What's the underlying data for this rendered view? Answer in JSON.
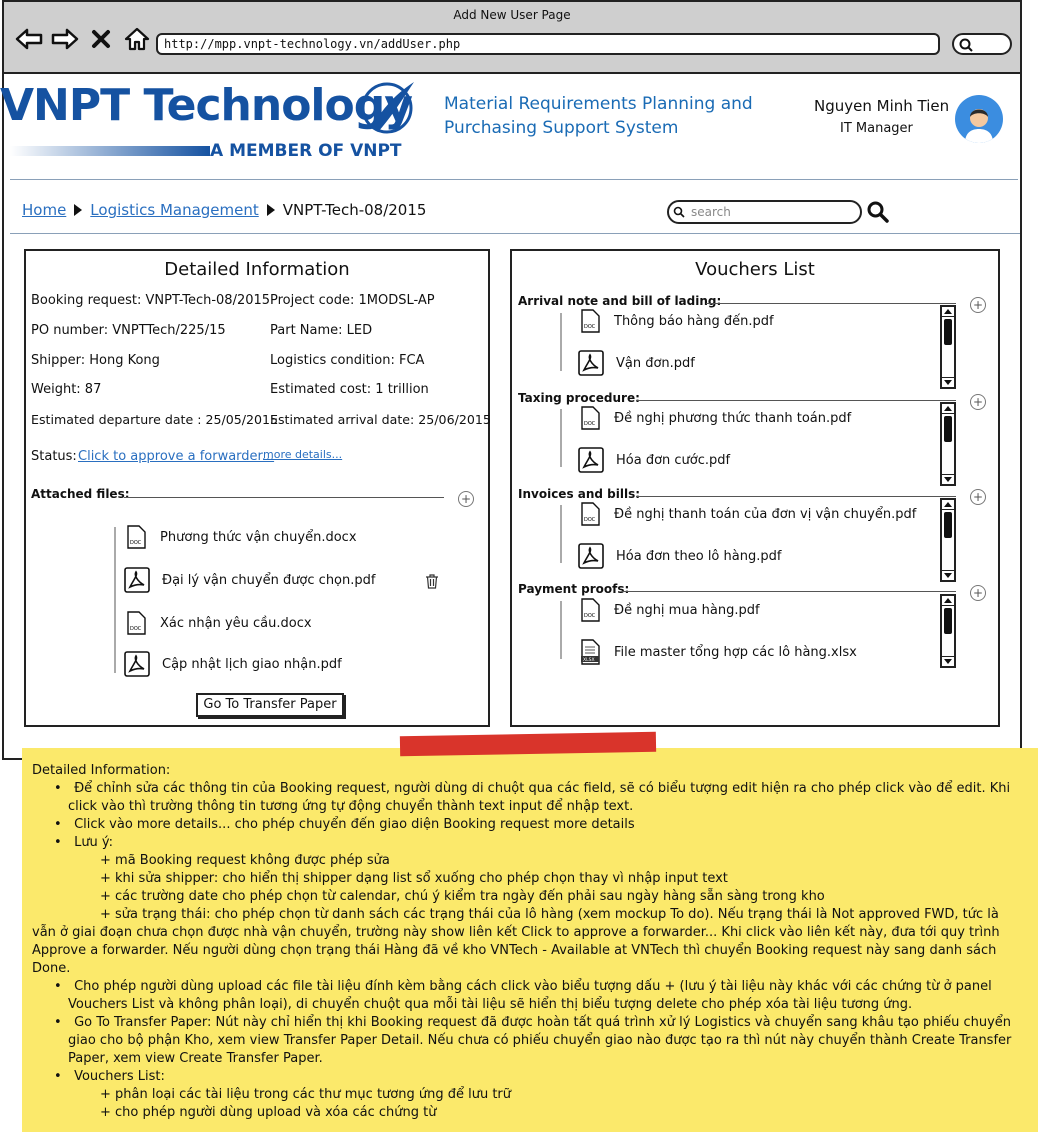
{
  "window": {
    "title": "Add New User Page",
    "url": "http://mpp.vnpt-technology.vn/addUser.php"
  },
  "header": {
    "logo_text": "VNPT Technology",
    "logo_tagline": "A MEMBER OF VNPT",
    "system_title_line1": "Material Requirements Planning and",
    "system_title_line2": "Purchasing Support System",
    "user_name": "Nguyen Minh Tien",
    "user_role": "IT Manager"
  },
  "breadcrumb": {
    "home": "Home",
    "section": "Logistics Management",
    "current": "VNPT-Tech-08/2015"
  },
  "search": {
    "placeholder": "search"
  },
  "detail": {
    "title": "Detailed Information",
    "booking_request": "Booking request: VNPT-Tech-08/2015",
    "project_code": "Project code: 1MODSL-AP",
    "po_number": "PO number: VNPTTech/225/15",
    "part_name": "Part Name: LED",
    "shipper": "Shipper: Hong Kong",
    "logistics_condition": "Logistics condition: FCA",
    "weight": "Weight: 87",
    "estimated_cost": "Estimated cost: 1 trillion",
    "departure_date": "Estimated departure date : 25/05/2015",
    "arrival_date": "Estimated arrival date: 25/06/2015",
    "status_label": "Status:",
    "status_link": "Click to approve a forwarder...",
    "more_details": "more details...",
    "attached_label": "Attached files:",
    "files": [
      {
        "name": "Phương thức vận chuyển.docx",
        "icon": "doc-icon"
      },
      {
        "name": "Đại lý vận chuyển được chọn.pdf",
        "icon": "pdf-icon"
      },
      {
        "name": "Xác nhận yêu cầu.docx",
        "icon": "doc-icon"
      },
      {
        "name": "Cập nhật lịch giao nhận.pdf",
        "icon": "pdf-icon"
      }
    ],
    "transfer_button": "Go To Transfer Paper"
  },
  "vouchers": {
    "title": "Vouchers List",
    "groups": [
      {
        "label": "Arrival note and bill of lading:",
        "files": [
          {
            "name": "Thông báo hàng đến.pdf",
            "icon": "doc-icon"
          },
          {
            "name": "Vận đơn.pdf",
            "icon": "pdf-icon"
          }
        ]
      },
      {
        "label": "Taxing procedure:",
        "files": [
          {
            "name": "Đề nghị phương thức thanh toán.pdf",
            "icon": "doc-icon"
          },
          {
            "name": "Hóa đơn cước.pdf",
            "icon": "pdf-icon"
          }
        ]
      },
      {
        "label": "Invoices and bills:",
        "files": [
          {
            "name": "Đề nghị thanh toán của đơn vị vận chuyển.pdf",
            "icon": "doc-icon"
          },
          {
            "name": "Hóa đơn theo lô hàng.pdf",
            "icon": "pdf-icon"
          }
        ]
      },
      {
        "label": "Payment proofs:",
        "files": [
          {
            "name": "Đề nghị mua hàng.pdf",
            "icon": "doc-icon"
          },
          {
            "name": "File master tổng hợp các lô hàng.xlsx",
            "icon": "xlsx-icon"
          }
        ]
      }
    ]
  },
  "note": {
    "heading": "Detailed Information:",
    "b1": "Để chỉnh sửa các thông tin của Booking request, người dùng di chuột qua các field, sẽ có biểu tượng edit hiện ra cho phép click vào để edit. Khi click vào thì trường thông tin tương ứng tự động chuyển thành text input để nhập text.",
    "b2": "Click vào more details... cho phép chuyển đến giao diện Booking request more details",
    "b3": "Lưu ý:",
    "s1": "+ mã Booking request không được phép sửa",
    "s2": "+ khi sửa shipper: cho hiển thị shipper dạng list sổ xuống cho phép chọn thay vì nhập input text",
    "s3": "+ các trường date cho phép chọn từ calendar, chú ý kiểm tra ngày đến phải sau ngày hàng sẵn sàng trong kho",
    "s4": "+ sửa trạng thái: cho phép chọn từ danh sách các trạng thái của lô hàng (xem mockup To do). Nếu trạng thái là Not approved FWD, tức là",
    "s4_cont": "vẫn ở giai đoạn chưa chọn được nhà vận chuyển, trường này show liên kết Click to approve a forwarder... Khi click vào liên kết này, đưa tới quy trình Approve a forwarder. Nếu người dùng chọn trạng thái Hàng đã về kho VNTech - Available at VNTech thì chuyển Booking request này sang danh sách Done.",
    "b4": "Cho phép người dùng upload các file tài liệu đính kèm bằng cách click vào biểu tượng dấu + (lưu ý tài liệu này khác với các chứng từ ở panel Vouchers List và không phân loại), di chuyển chuột qua mỗi tài liệu sẽ hiển thị biểu tượng delete cho phép xóa tài liệu tương ứng.",
    "b5": "Go To Transfer Paper: Nút này chỉ hiển thị khi Booking request đã được hoàn tất quá trình xử lý Logistics và chuyển sang khâu tạo phiếu chuyển giao cho bộ phận Kho, xem view Transfer Paper Detail. Nếu chưa có phiếu chuyển giao nào được tạo ra thì nút này chuyển thành Create Transfer Paper, xem view Create Transfer Paper.",
    "b6": "Vouchers List:",
    "s5": "+ phân loại các tài liệu trong các thư mục tương ứng để lưu trữ",
    "s6": "+ cho phép người dùng upload và xóa các chứng từ"
  },
  "colors": {
    "brand": "#1552a1",
    "link": "#2a6fc0",
    "note": "#fbe96b",
    "tape": "#d9342b"
  }
}
